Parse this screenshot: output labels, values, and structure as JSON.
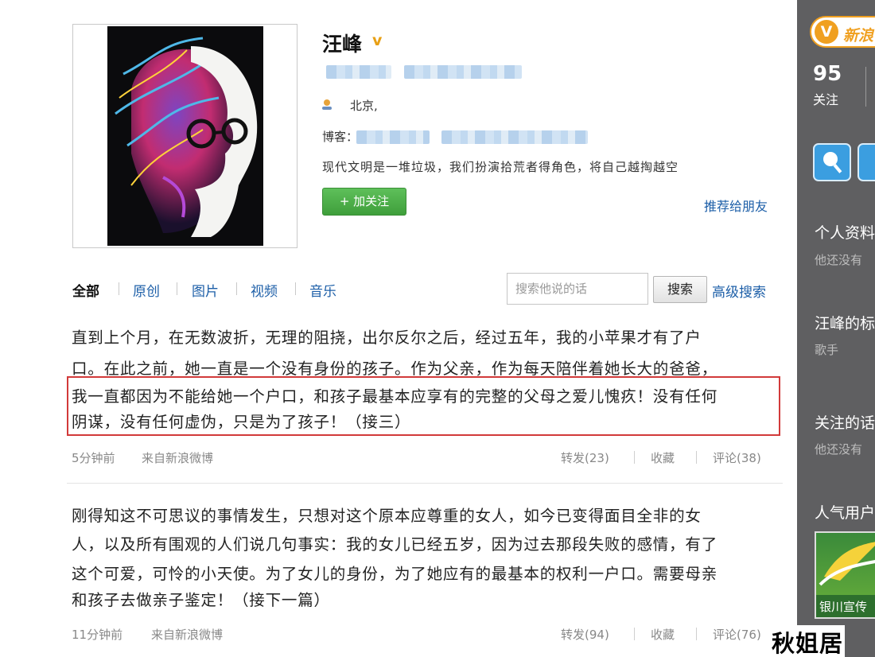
{
  "profile": {
    "name": "汪峰",
    "verified_mark": "v",
    "location": "北京,",
    "blog_label": "博客：",
    "bio": "现代文明是一堆垃圾，我们扮演拾荒者得角色，将自己越掏越空",
    "follow_label": "+ 加关注",
    "recommend_label": "推荐给朋友"
  },
  "tabs": [
    "全部",
    "原创",
    "图片",
    "视频",
    "音乐"
  ],
  "search": {
    "placeholder": "搜索他说的话",
    "button_label": "搜索",
    "advanced_label": "高级搜索"
  },
  "posts": [
    {
      "lines": [
        "直到上个月，在无数波折，无理的阻挠，出尔反尔之后，经过五年，我的小苹果才有了户",
        "口。在此之前，她一直是一个没有身份的孩子。作为父亲，作为每天陪伴着她长大的爸爸，",
        "我一直都因为不能给她一个户口，和孩子最基本应享有的完整的父母之爱儿愧疚！没有任何",
        "阴谋，没有任何虚伪，只是为了孩子！（接三）"
      ],
      "time": "5分钟前",
      "source": "来自新浪微博",
      "repost": "转发(23)",
      "favorite": "收藏",
      "comment": "评论(38)"
    },
    {
      "lines": [
        "刚得知这不可思议的事情发生，只想对这个原本应尊重的女人，如今已变得面目全非的女",
        "人，以及所有围观的人们说几句事实：我的女儿已经五岁，因为过去那段失败的感情，有了",
        "这个可爱，可怜的小天使。为了女儿的身份，为了她应有的最基本的权利一户口。需要母亲",
        "和孩子去做亲子鉴定！（接下一篇）"
      ],
      "time": "11分钟前",
      "source": "来自新浪微博",
      "repost": "转发(94)",
      "favorite": "收藏",
      "comment": "评论(76)"
    }
  ],
  "sidebar": {
    "badge_logo": "V",
    "badge_text": "新浪",
    "follow_count": "95",
    "follow_label": "关注",
    "personal_info_title": "个人资料",
    "personal_info_sub": "他还没有",
    "tag_title": "汪峰的标",
    "tag_sub": "歌手",
    "following_title": "关注的话",
    "following_sub": "他还没有",
    "popular_title": "人气用户",
    "thumb_caption": "银川宣传"
  },
  "watermark": "秋姐居",
  "colors": {
    "link_blue": "#1d5fa8",
    "follow_green": "#4caf48",
    "highlight_red": "#d23a3a",
    "sidebar_gray": "#5f5f61",
    "sina_orange": "#f0a020"
  },
  "icons": [
    "location-pin-icon",
    "verified-v-icon",
    "plus-icon",
    "sina-weibo-logo-icon",
    "sidebar-app-icon"
  ]
}
